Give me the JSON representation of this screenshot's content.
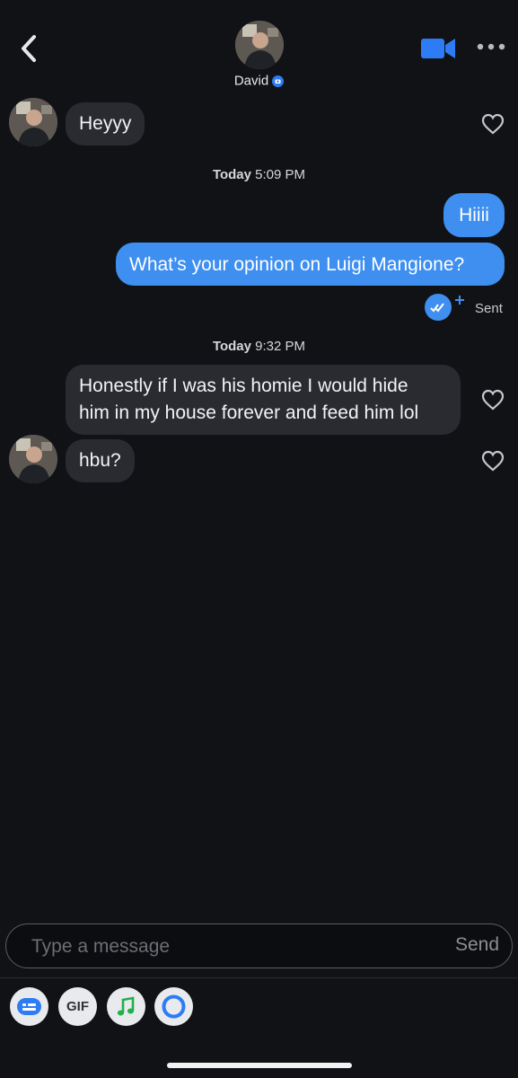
{
  "header": {
    "name": "David",
    "back_icon": "chevron-left-icon",
    "video_icon": "video-camera-icon",
    "more_icon": "more-dots-icon",
    "verified_icon": "verified-camera-badge-icon"
  },
  "messages": {
    "m1": "Heyyy",
    "ts1_day": "Today",
    "ts1_time": "5:09 PM",
    "m2": "Hiiii",
    "m3": "What’s your opinion on Luigi Mangione?",
    "sent_status": "Sent",
    "ts2_day": "Today",
    "ts2_time": "9:32 PM",
    "m4_line1": "Honestly if I was his homie I would hide",
    "m4_line2": "him in my house forever and feed him lol",
    "m5": "hbu?"
  },
  "composer": {
    "placeholder": "Type a message",
    "send_label": "Send"
  },
  "toolbar": {
    "gif_label": "GIF",
    "icons": [
      "sticker-icon",
      "gif-icon",
      "music-note-icon",
      "circle-icon"
    ]
  },
  "colors": {
    "background": "#111216",
    "incoming_bubble": "#292b31",
    "outgoing_bubble": "#3e8ff0",
    "accent": "#2d7cf6"
  }
}
